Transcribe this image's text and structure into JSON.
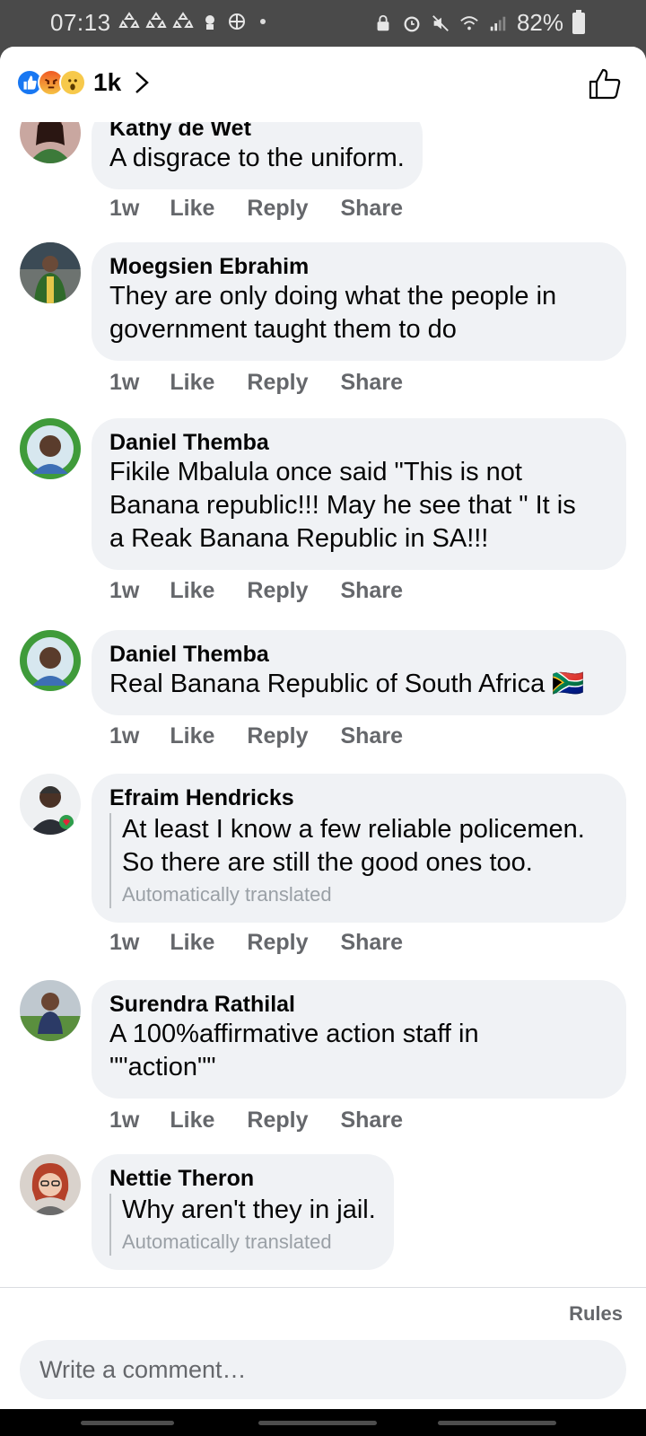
{
  "status_bar": {
    "time": "07:13",
    "battery": "82%"
  },
  "header": {
    "reaction_count": "1k",
    "reaction_icons": [
      "like-reaction-icon",
      "angry-reaction-icon",
      "wow-reaction-icon"
    ]
  },
  "comments": [
    {
      "name": "Kathy de Wet",
      "text": "A disgrace to the uniform.",
      "translated": false,
      "time": "1w"
    },
    {
      "name": "Moegsien Ebrahim",
      "text_lines": [
        "They are only doing what the people in",
        "government taught them to do"
      ],
      "translated": false,
      "time": "1w"
    },
    {
      "name": "Daniel Themba",
      "text_lines": [
        "Fikile Mbalula once said \"This is not",
        "Banana republic!!! May he see that \" It is",
        "a Reak Banana Republic in SA!!!"
      ],
      "translated": false,
      "time": "1w"
    },
    {
      "name": "Daniel Themba",
      "text": "Real Banana Republic of South Africa 🇿🇦",
      "translated": false,
      "time": "1w"
    },
    {
      "name": "Efraim Hendricks",
      "text_lines": [
        "At least I know a few reliable policemen.",
        "So there are still the good ones too."
      ],
      "translated": true,
      "time": "1w"
    },
    {
      "name": "Surendra Rathilal",
      "text_lines": [
        "A 100%affirmative action staff in",
        "\"\"action\"\""
      ],
      "translated": false,
      "time": "1w"
    },
    {
      "name": "Nettie Theron",
      "text": "Why aren't they in jail.",
      "translated": true
    }
  ],
  "actions": {
    "like": "Like",
    "reply": "Reply",
    "share": "Share"
  },
  "translation_note": "Automatically translated",
  "footer": {
    "rules": "Rules",
    "comment_placeholder": "Write a comment…"
  },
  "colors": {
    "bubble": "#f0f2f5",
    "secondary_text": "#65676b",
    "like_blue": "#1877f2"
  }
}
